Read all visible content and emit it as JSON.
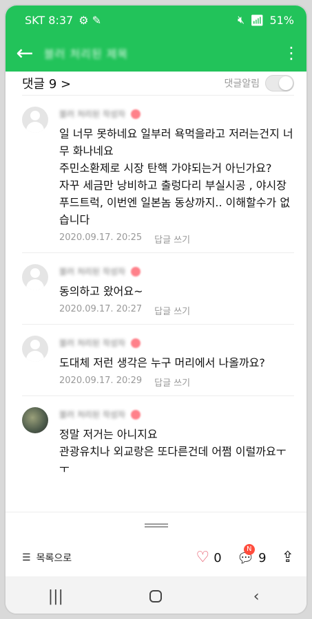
{
  "statusbar": {
    "carrier_time": "SKT 8:37",
    "battery": "51%"
  },
  "appbar": {
    "title": "블러 처리된 제목",
    "back_icon": "arrow-left-icon",
    "menu_icon": "kebab-icon"
  },
  "comments_header": {
    "count": "댓글 9 >",
    "notify_label": "댓글알림"
  },
  "comments": [
    {
      "author": "블러 처리된 작성자",
      "text": "일 너무 못하네요 일부러 욕먹을라고 저러는건지 너무 화나네요\n주민소환제로 시장 탄핵 가야되는거 아닌가요?\n자꾸 세금만 낭비하고 출렁다리 부실시공 , 야시장 푸드트럭, 이번엔 일본놈 동상까지.. 이해할수가 없습니다",
      "time": "2020.09.17. 20:25",
      "reply": "답글 쓰기",
      "avatar": "default"
    },
    {
      "author": "블러 처리된 작성자",
      "text": "동의하고 왔어요~",
      "time": "2020.09.17. 20:27",
      "reply": "답글 쓰기",
      "avatar": "default"
    },
    {
      "author": "블러 처리된 작성자",
      "text": "도대체 저런 생각은 누구 머리에서 나올까요?",
      "time": "2020.09.17. 20:29",
      "reply": "답글 쓰기",
      "avatar": "default"
    },
    {
      "author": "블러 처리된 작성자",
      "text": "정말 저거는 아니지요\n관광유치나 외교랑은 또다른건데 어쩜 이럴까요ㅜㅜ",
      "time": "",
      "reply": "",
      "avatar": "photo"
    }
  ],
  "footer": {
    "list_label": "목록으로",
    "like_count": "0",
    "comment_count": "9",
    "new_badge": "N"
  },
  "colors": {
    "header_green": "#22c35a"
  }
}
